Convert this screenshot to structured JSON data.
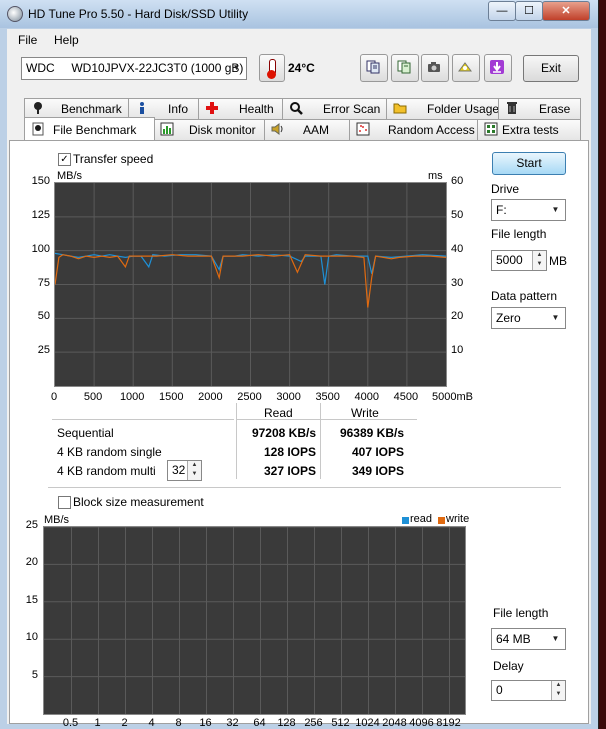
{
  "window": {
    "title": "HD Tune Pro 5.50 - Hard Disk/SSD Utility"
  },
  "titlebar_buttons": {
    "minimize": "—",
    "maximize": "☐",
    "close": "✕"
  },
  "menu": {
    "file": "File",
    "help": "Help"
  },
  "toolbar": {
    "drive": "WDC     WD10JPVX-22JC3T0 (1000 gB)",
    "temperature": "24°C",
    "exit_label": "Exit",
    "icons": [
      "copy-text-icon",
      "copy-info-icon",
      "screenshot-icon",
      "options-icon",
      "save-icon"
    ]
  },
  "tabs_top": [
    {
      "label": "Benchmark",
      "icon": "benchmark-icon"
    },
    {
      "label": "Info",
      "icon": "info-icon"
    },
    {
      "label": "Health",
      "icon": "health-icon"
    },
    {
      "label": "Error Scan",
      "icon": "error-scan-icon"
    },
    {
      "label": "Folder Usage",
      "icon": "folder-icon"
    },
    {
      "label": "Erase",
      "icon": "erase-icon"
    }
  ],
  "tabs_bottom": [
    {
      "label": "File Benchmark",
      "icon": "file-benchmark-icon",
      "active": true
    },
    {
      "label": "Disk monitor",
      "icon": "disk-monitor-icon"
    },
    {
      "label": "AAM",
      "icon": "aam-icon"
    },
    {
      "label": "Random Access",
      "icon": "random-access-icon"
    },
    {
      "label": "Extra tests",
      "icon": "extra-tests-icon"
    }
  ],
  "transfer": {
    "checkbox_label": "Transfer speed",
    "checked": true,
    "y_unit_left": "MB/s",
    "y_unit_right": "ms",
    "y_left_ticks": [
      "150",
      "125",
      "100",
      "75",
      "50",
      "25"
    ],
    "y_right_ticks": [
      "60",
      "50",
      "40",
      "30",
      "20",
      "10"
    ],
    "x_ticks": [
      "0",
      "500",
      "1000",
      "1500",
      "2000",
      "2500",
      "3000",
      "3500",
      "4000",
      "4500",
      "5000mB"
    ]
  },
  "results": {
    "col_read": "Read",
    "col_write": "Write",
    "rows": [
      {
        "label": "Sequential",
        "read": "97208 KB/s",
        "write": "96389 KB/s"
      },
      {
        "label": "4 KB random single",
        "read": "128 IOPS",
        "write": "407 IOPS"
      },
      {
        "label": "4 KB random multi",
        "read": "327 IOPS",
        "write": "349 IOPS"
      }
    ],
    "queue_depth": "32"
  },
  "side": {
    "start_label": "Start",
    "drive_label": "Drive",
    "drive_value": "F:",
    "file_length_label": "File length",
    "file_length_value": "5000",
    "file_length_unit": "MB",
    "pattern_label": "Data pattern",
    "pattern_value": "Zero"
  },
  "block": {
    "checkbox_label": "Block size measurement",
    "checked": false,
    "y_unit": "MB/s",
    "y_ticks": [
      "25",
      "20",
      "15",
      "10",
      "5"
    ],
    "x_ticks": [
      "0.5",
      "1",
      "2",
      "4",
      "8",
      "16",
      "32",
      "64",
      "128",
      "256",
      "512",
      "1024",
      "2048",
      "4096",
      "8192"
    ],
    "legend_read": "read",
    "legend_write": "write",
    "file_length_label": "File length",
    "file_length_value": "64 MB",
    "delay_label": "Delay",
    "delay_value": "0"
  },
  "colors": {
    "read": "#1e90d6",
    "write": "#e06a10",
    "graph_bg": "#3a3a3a",
    "grid": "#5a5a5a"
  },
  "chart_data": {
    "type": "line",
    "x_unit": "mB",
    "xlim": [
      0,
      5000
    ],
    "ylim": [
      0,
      150
    ],
    "y2lim": [
      0,
      60
    ],
    "y_unit": "MB/s",
    "y2_unit": "ms",
    "series": [
      {
        "name": "read",
        "color": "#1e90d6",
        "points": [
          [
            0,
            98
          ],
          [
            100,
            97
          ],
          [
            200,
            96
          ],
          [
            300,
            95
          ],
          [
            400,
            96
          ],
          [
            500,
            97
          ],
          [
            600,
            96
          ],
          [
            700,
            97
          ],
          [
            800,
            96
          ],
          [
            900,
            95
          ],
          [
            1000,
            96
          ],
          [
            1100,
            96
          ],
          [
            1200,
            88
          ],
          [
            1250,
            97
          ],
          [
            1400,
            96
          ],
          [
            1600,
            97
          ],
          [
            1800,
            97
          ],
          [
            2000,
            96
          ],
          [
            2100,
            86
          ],
          [
            2150,
            96
          ],
          [
            2300,
            96
          ],
          [
            2400,
            97
          ],
          [
            2600,
            96
          ],
          [
            2800,
            97
          ],
          [
            3000,
            96
          ],
          [
            3150,
            92
          ],
          [
            3200,
            96
          ],
          [
            3400,
            96
          ],
          [
            3450,
            75
          ],
          [
            3500,
            96
          ],
          [
            3600,
            97
          ],
          [
            3800,
            96
          ],
          [
            4000,
            96
          ],
          [
            4050,
            83
          ],
          [
            4100,
            96
          ],
          [
            4300,
            95
          ],
          [
            4500,
            96
          ],
          [
            4700,
            97
          ],
          [
            5000,
            96
          ]
        ]
      },
      {
        "name": "write",
        "color": "#e06a10",
        "points": [
          [
            0,
            75
          ],
          [
            50,
            95
          ],
          [
            100,
            97
          ],
          [
            200,
            96
          ],
          [
            300,
            94
          ],
          [
            400,
            96
          ],
          [
            500,
            95
          ],
          [
            600,
            96
          ],
          [
            700,
            95
          ],
          [
            800,
            96
          ],
          [
            900,
            88
          ],
          [
            950,
            96
          ],
          [
            1100,
            96
          ],
          [
            1300,
            96
          ],
          [
            1500,
            97
          ],
          [
            1700,
            96
          ],
          [
            1900,
            96
          ],
          [
            2000,
            96
          ],
          [
            2100,
            80
          ],
          [
            2150,
            96
          ],
          [
            2400,
            96
          ],
          [
            2600,
            97
          ],
          [
            2800,
            96
          ],
          [
            3000,
            97
          ],
          [
            3100,
            84
          ],
          [
            3200,
            97
          ],
          [
            3400,
            96
          ],
          [
            3600,
            96
          ],
          [
            3800,
            96
          ],
          [
            3950,
            95
          ],
          [
            4000,
            58
          ],
          [
            4050,
            80
          ],
          [
            4100,
            96
          ],
          [
            4300,
            94
          ],
          [
            4400,
            95
          ],
          [
            4600,
            96
          ],
          [
            4800,
            96
          ],
          [
            5000,
            95
          ]
        ]
      }
    ]
  }
}
